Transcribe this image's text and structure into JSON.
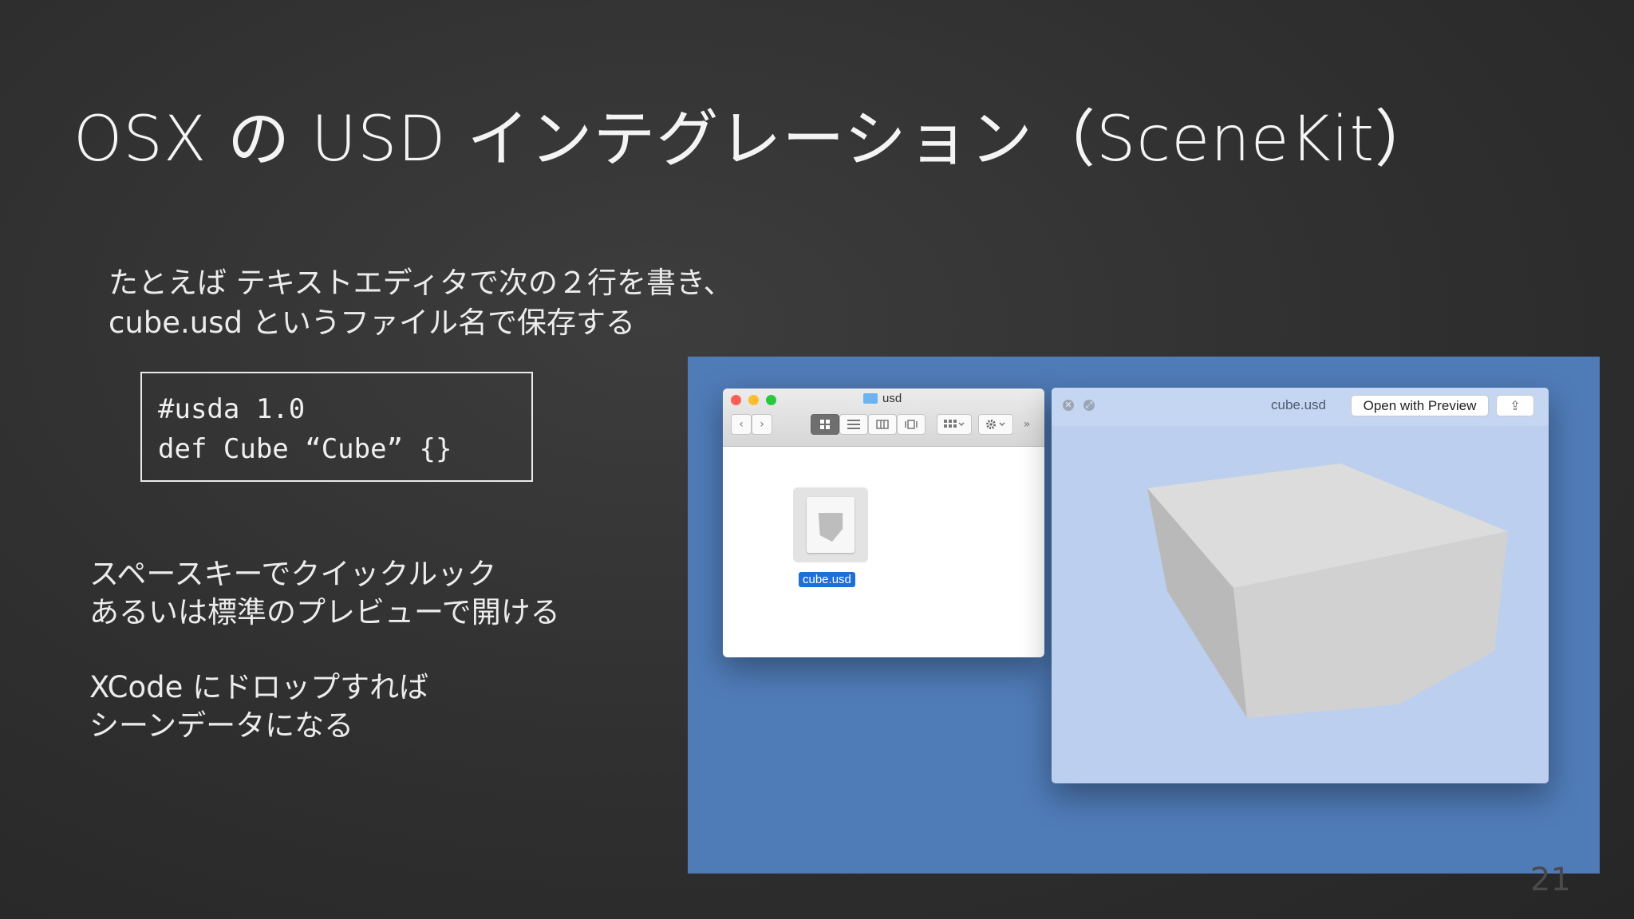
{
  "slide": {
    "title": "OSX の USD インテグレーション（SceneKit）",
    "intro_line1": "たとえば テキストエディタで次の２行を書き、",
    "intro_line2": "cube.usd というファイル名で保存する",
    "code_line1": "#usda 1.0",
    "code_line2": "def Cube “Cube” {}",
    "para1_line1": "スペースキーでクイックルック",
    "para1_line2": "あるいは標準のプレビューで開ける",
    "para2_line1": "XCode にドロップすれば",
    "para2_line2": "シーンデータになる",
    "page_number": "21"
  },
  "finder": {
    "window_title": "usd",
    "back_icon": "‹",
    "forward_icon": "›",
    "more_icon": "»",
    "file_name": "cube.usd"
  },
  "preview": {
    "file_name": "cube.usd",
    "open_button": "Open with Preview",
    "close_glyph": "✕",
    "fullscreen_glyph": "⤢",
    "share_glyph": "⇪"
  },
  "colors": {
    "desktop": "#4f7bb7",
    "preview_bg": "#bccfee",
    "selection": "#1f6fd6"
  }
}
